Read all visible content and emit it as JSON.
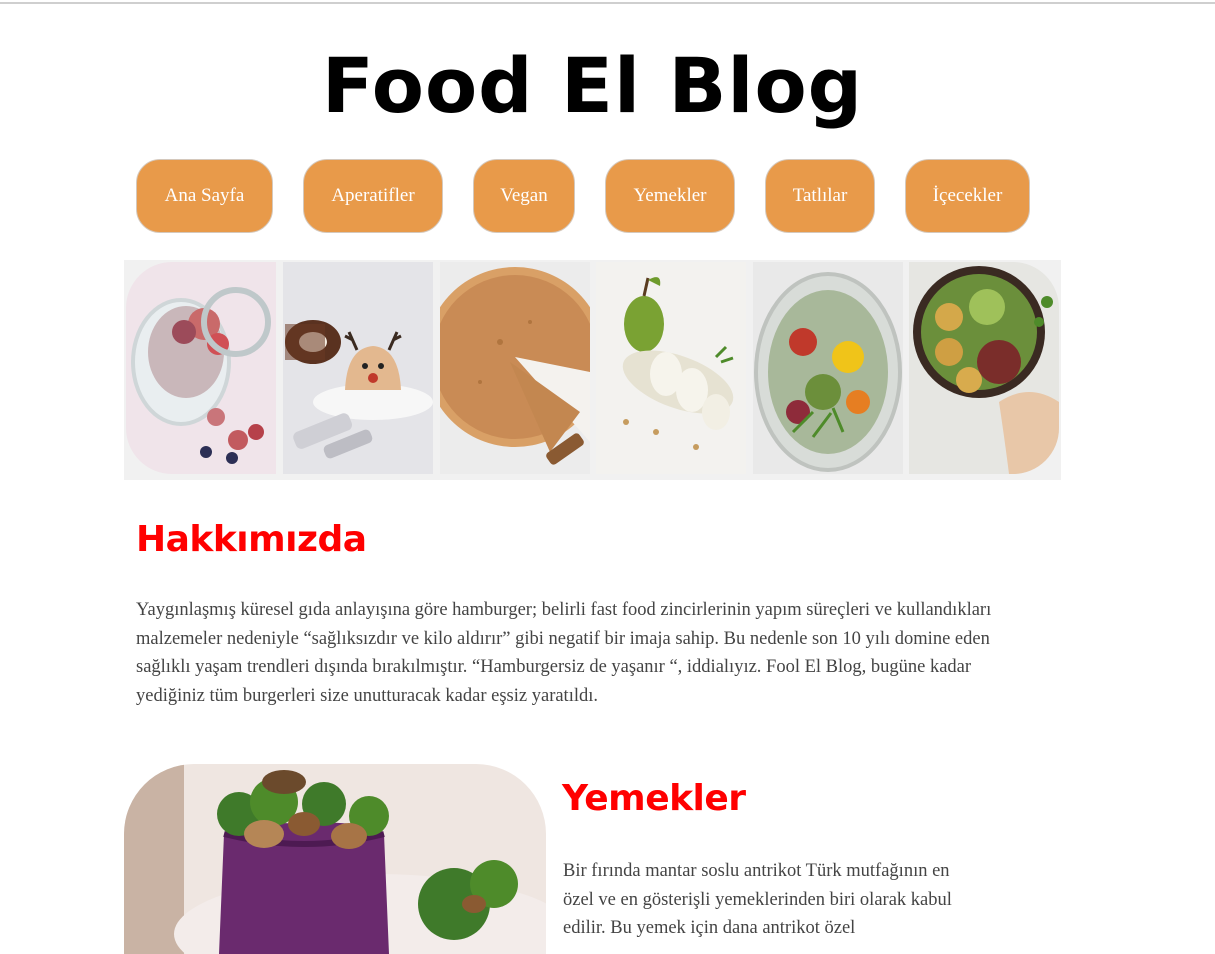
{
  "site": {
    "title": "Food El Blog"
  },
  "nav": {
    "items": [
      {
        "label": "Ana Sayfa"
      },
      {
        "label": "Aperatifler"
      },
      {
        "label": "Vegan"
      },
      {
        "label": "Yemekler"
      },
      {
        "label": "Tatlılar"
      },
      {
        "label": "İçecekler"
      }
    ]
  },
  "gallery": {
    "images": [
      {
        "name": "chia-pudding-figs-photo"
      },
      {
        "name": "dessert-cake-photo"
      },
      {
        "name": "pie-slice-photo"
      },
      {
        "name": "pear-salad-photo"
      },
      {
        "name": "salad-glass-photo"
      },
      {
        "name": "bowl-hand-photo"
      }
    ]
  },
  "about": {
    "heading": "Hakkımızda",
    "text": "Yaygınlaşmış küresel gıda anlayışına göre hamburger; belirli fast food zincirlerinin yapım süreçleri ve kullandıkları malzemeler nedeniyle “sağlıksızdır ve kilo aldırır” gibi negatif bir imaja sahip. Bu nedenle son 10 yılı domine eden sağlıklı yaşam trendleri dışında bırakılmıştır. “Hamburgersiz de yaşanır “, iddialıyız. Fool El Blog, bugüne kadar yediğiniz tüm burgerleri size unutturacak kadar eşsiz yaratıldı."
  },
  "dishes": {
    "heading": "Yemekler",
    "text": "Bir fırında mantar soslu antrikot Türk mutfağının en özel ve en gösterişli yemeklerinden biri olarak kabul edilir. Bu yemek için dana antrikot özel"
  },
  "colors": {
    "nav_button": "#e89a4a",
    "heading": "#ff0000",
    "body_text": "#444444"
  }
}
